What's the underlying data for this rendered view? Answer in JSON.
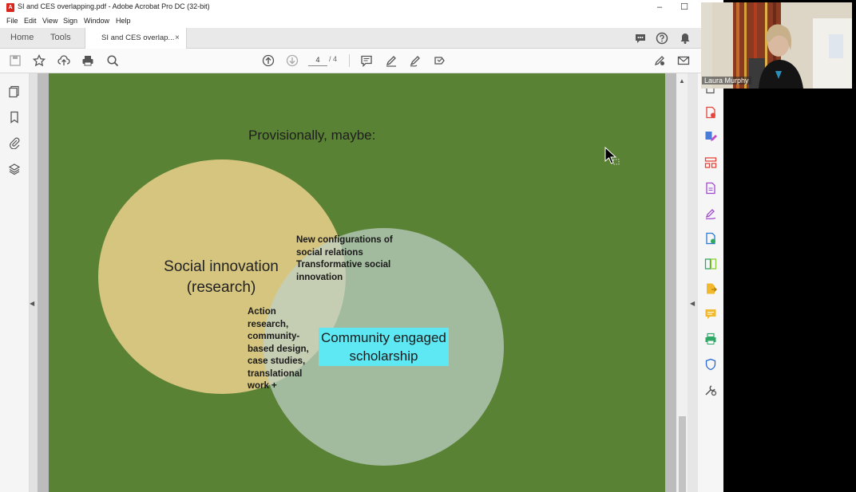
{
  "window": {
    "title": "SI and CES overlapping.pdf - Adobe Acrobat Pro DC (32-bit)",
    "minimize": "–",
    "maximize": "☐"
  },
  "menu": [
    "File",
    "Edit",
    "View",
    "Sign",
    "Window",
    "Help"
  ],
  "tabs": {
    "home": "Home",
    "tools": "Tools",
    "document": "SI and CES overlap...",
    "close": "×"
  },
  "toolbar": {
    "page_current": "4",
    "page_total": "/ 4"
  },
  "slide": {
    "title": "Provisionally, maybe:",
    "circle_a_label": "Social innovation\n(research)",
    "circle_b_label": "Community engaged\nscholarship",
    "overlap_top": "New configurations of\nsocial relations\nTransformative social\ninnovation",
    "overlap_left": "Action\nresearch,\ncommunity-\nbased design,\ncase studies,\ntranslational\nwork +"
  },
  "video": {
    "participant_name": "Laura Murphy"
  },
  "colors": {
    "slide_background": "#5a8234",
    "circle_a": "#d6c57f",
    "circle_b": "#bed0c8",
    "highlight": "#5de8f3",
    "acrobat_red": "#d9261c"
  },
  "icons": {
    "toolbar": [
      "save-icon",
      "bookmark-star-icon",
      "upload-icon",
      "print-icon",
      "zoom-search-icon",
      "page-up-icon",
      "page-down-icon",
      "comment-icon",
      "highlight-pen-icon",
      "sign-icon",
      "stamp-icon",
      "edit-sign-icon",
      "email-icon"
    ],
    "left_panel": [
      "page-thumbnails-icon",
      "bookmarks-icon",
      "attachments-icon",
      "layers-icon"
    ],
    "right_panel": [
      "export-pdf-icon",
      "create-pdf-icon",
      "edit-pdf-icon",
      "organize-pages-icon",
      "combine-files-icon",
      "fill-sign-icon",
      "enhance-scans-icon",
      "compare-files-icon",
      "export-file-icon",
      "comment-tool-icon",
      "print-production-icon",
      "protect-icon",
      "more-tools-icon"
    ]
  }
}
